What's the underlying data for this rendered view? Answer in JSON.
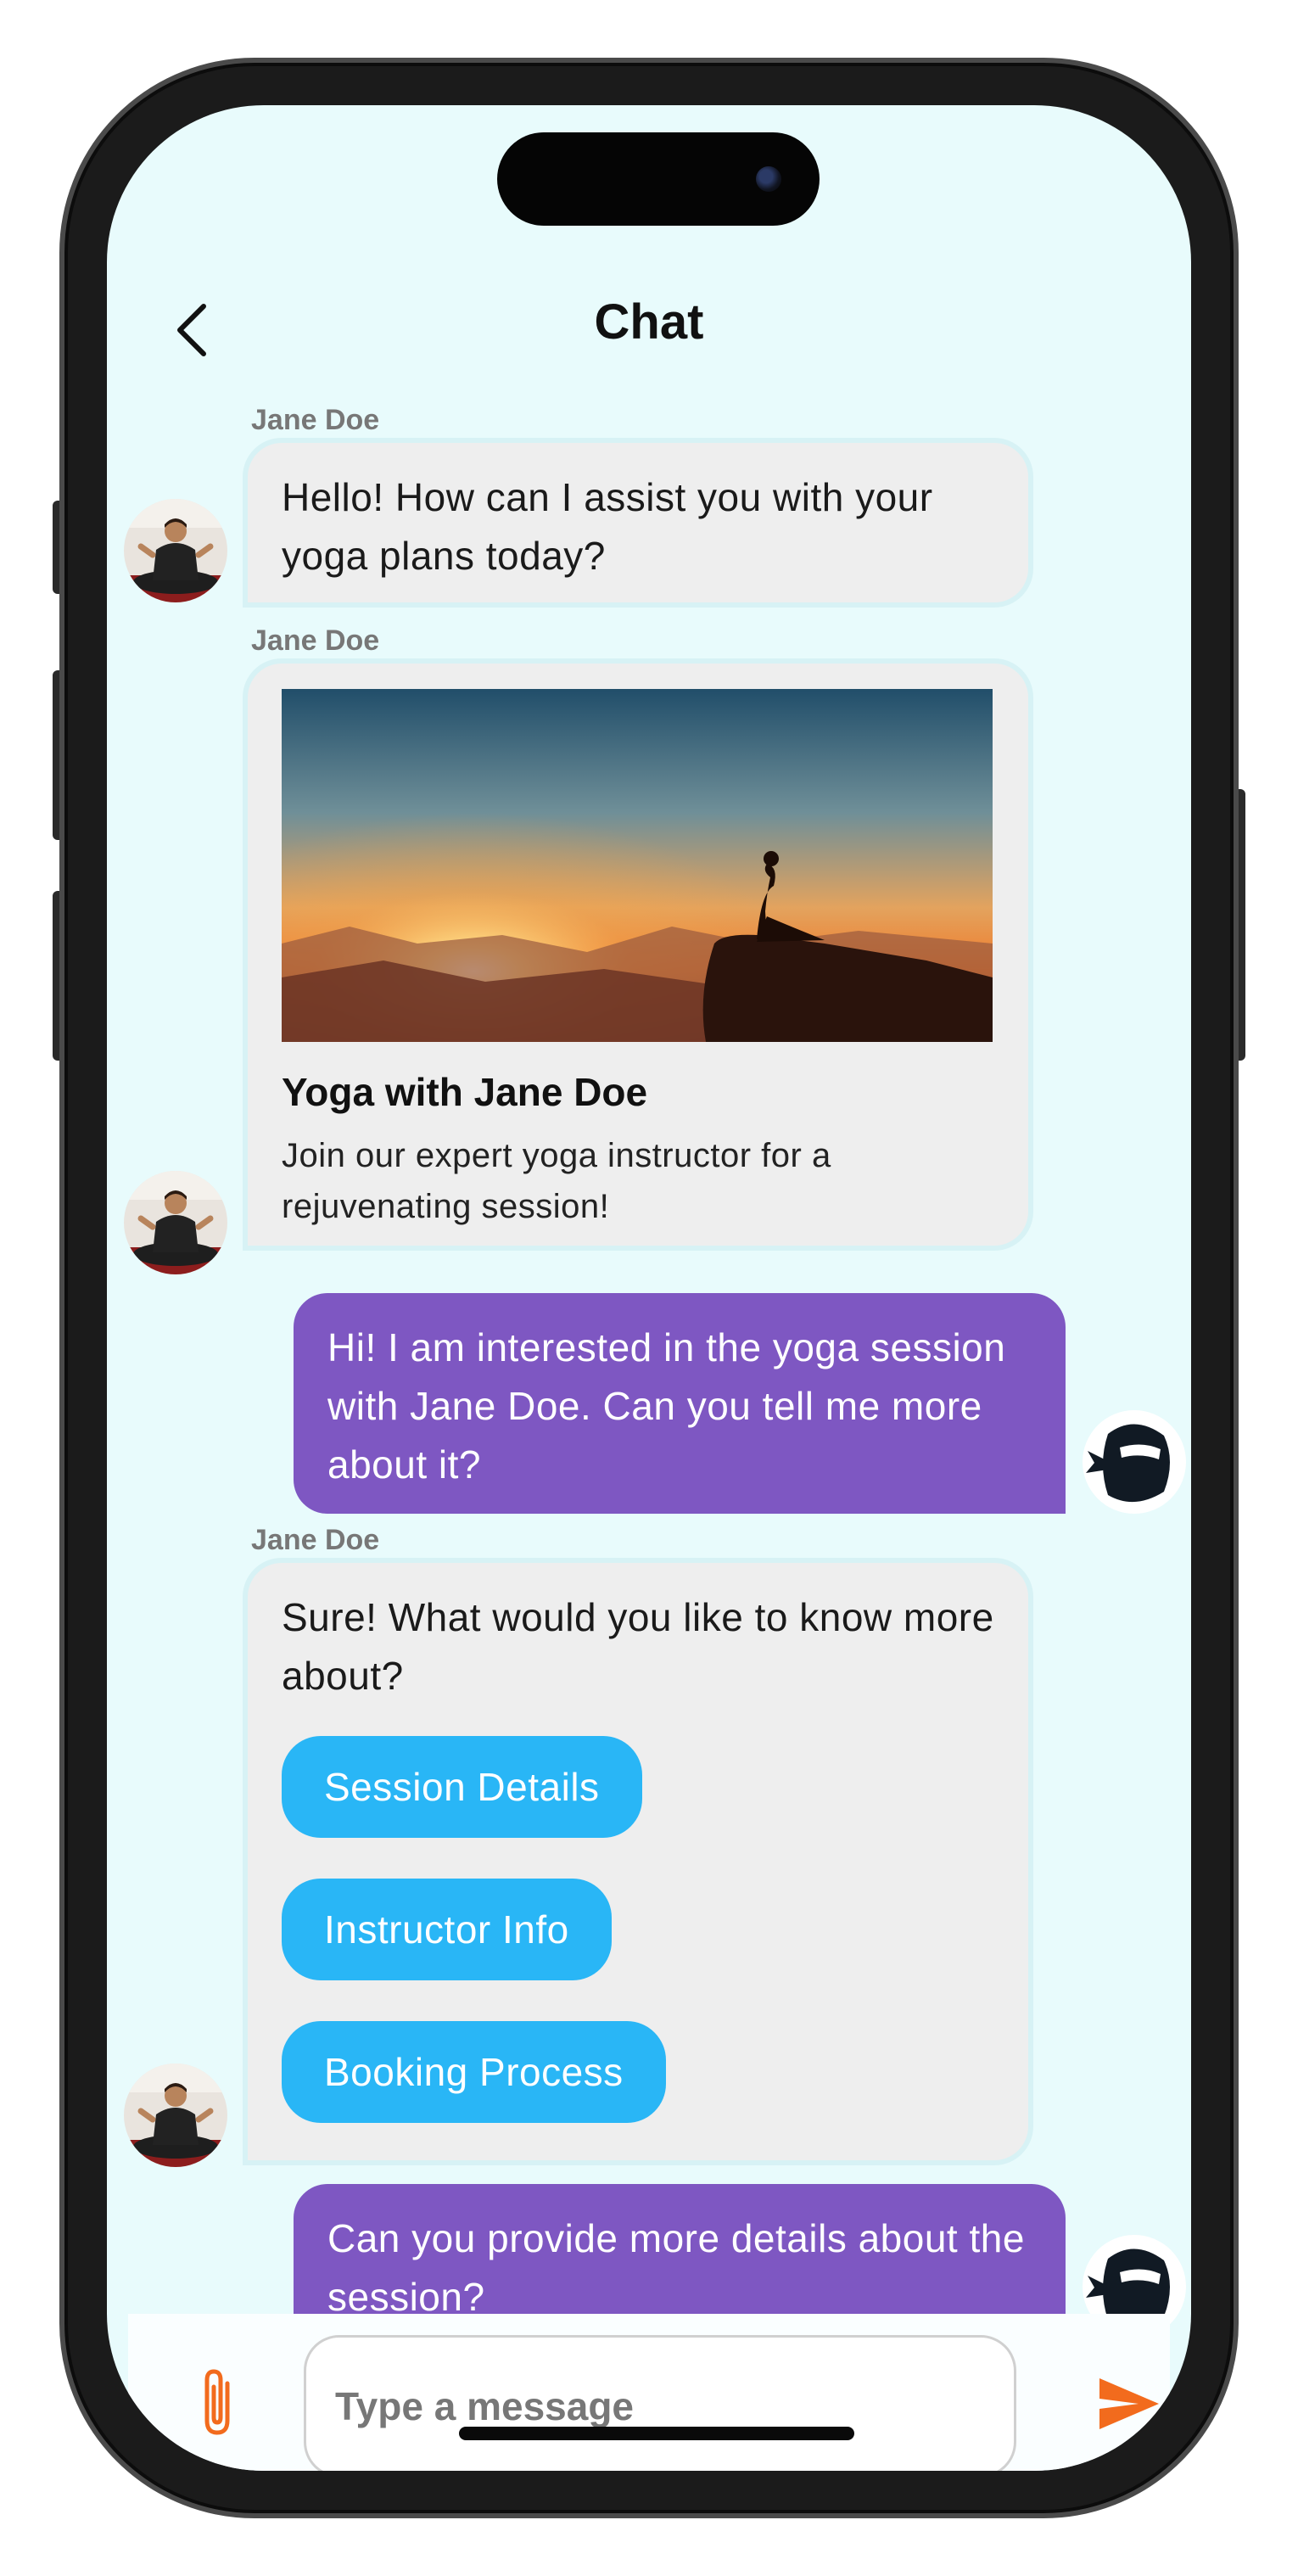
{
  "header": {
    "title": "Chat"
  },
  "messages": {
    "m1": {
      "sender": "Jane Doe",
      "text": "Hello! How can I assist you with your yoga plans today?"
    },
    "m2": {
      "sender": "Jane Doe",
      "card_title": "Yoga with Jane Doe",
      "card_desc": "Join our expert yoga instructor for a rejuvenating session!"
    },
    "m3": {
      "text": "Hi! I am interested in the yoga session with Jane Doe. Can you tell me more about it?"
    },
    "m4": {
      "sender": "Jane Doe",
      "text": "Sure! What would you like to know more about?",
      "options": [
        "Session Details",
        "Instructor Info",
        "Booking Process"
      ]
    },
    "m5": {
      "text": "Can you provide more details about the session?"
    }
  },
  "composer": {
    "placeholder": "Type a message"
  },
  "colors": {
    "background": "#e8fbfc",
    "incoming_bubble": "#eeeeee",
    "outgoing_bubble": "#7e57c2",
    "option_button": "#29b6f6",
    "accent": "#f26b1d"
  },
  "icons": {
    "back": "chevron-left-icon",
    "attach": "paperclip-icon",
    "send": "send-icon",
    "user_avatar": "ninja-icon"
  }
}
